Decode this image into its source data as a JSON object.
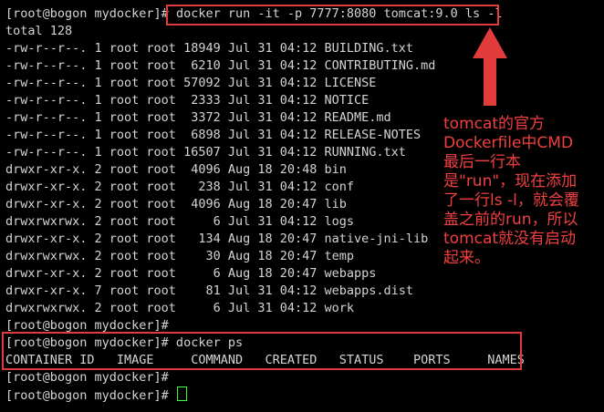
{
  "terminal": {
    "cmd_line_prompt": "[root@bogon mydocker]#",
    "cmd_line_command": "docker run -it -p 7777:8080 tomcat:9.0 ls -l",
    "total": "total 128",
    "listing": [
      "-rw-r--r--. 1 root root 18949 Jul 31 04:12 BUILDING.txt",
      "-rw-r--r--. 1 root root  6210 Jul 31 04:12 CONTRIBUTING.md",
      "-rw-r--r--. 1 root root 57092 Jul 31 04:12 LICENSE",
      "-rw-r--r--. 1 root root  2333 Jul 31 04:12 NOTICE",
      "-rw-r--r--. 1 root root  3372 Jul 31 04:12 README.md",
      "-rw-r--r--. 1 root root  6898 Jul 31 04:12 RELEASE-NOTES",
      "-rw-r--r--. 1 root root 16507 Jul 31 04:12 RUNNING.txt",
      "drwxr-xr-x. 2 root root  4096 Aug 18 20:48 bin",
      "drwxr-xr-x. 2 root root   238 Jul 31 04:12 conf",
      "drwxr-xr-x. 2 root root  4096 Aug 18 20:47 lib",
      "drwxrwxrwx. 2 root root     6 Jul 31 04:12 logs",
      "drwxr-xr-x. 2 root root   134 Aug 18 20:47 native-jni-lib",
      "drwxrwxrwx. 2 root root    30 Aug 18 20:47 temp",
      "drwxr-xr-x. 2 root root     6 Aug 18 20:47 webapps",
      "drwxr-xr-x. 7 root root    81 Jul 31 04:12 webapps.dist",
      "drwxrwxrwx. 2 root root     6 Jul 31 04:12 work"
    ],
    "prompt_after_listing": "[root@bogon mydocker]#",
    "ps_command_line": "[root@bogon mydocker]# docker ps",
    "ps_header": "CONTAINER ID   IMAGE     COMMAND   CREATED   STATUS    PORTS     NAMES",
    "prompt_blank": "[root@bogon mydocker]#",
    "prompt_active": "[root@bogon mydocker]#"
  },
  "annotation": {
    "text": "tomcat的官方\nDockerfile中CMD\n最后一行本\n是\"run\"，现在添加\n了一行ls -l，就会覆\n盖之前的run，所以\ntomcat就没有启动\n起来。",
    "color": "#f04040"
  },
  "colors": {
    "background": "#000000",
    "foreground": "#d4d4d4",
    "highlight_box": "#e23b3b",
    "cursor": "#33ff33"
  }
}
